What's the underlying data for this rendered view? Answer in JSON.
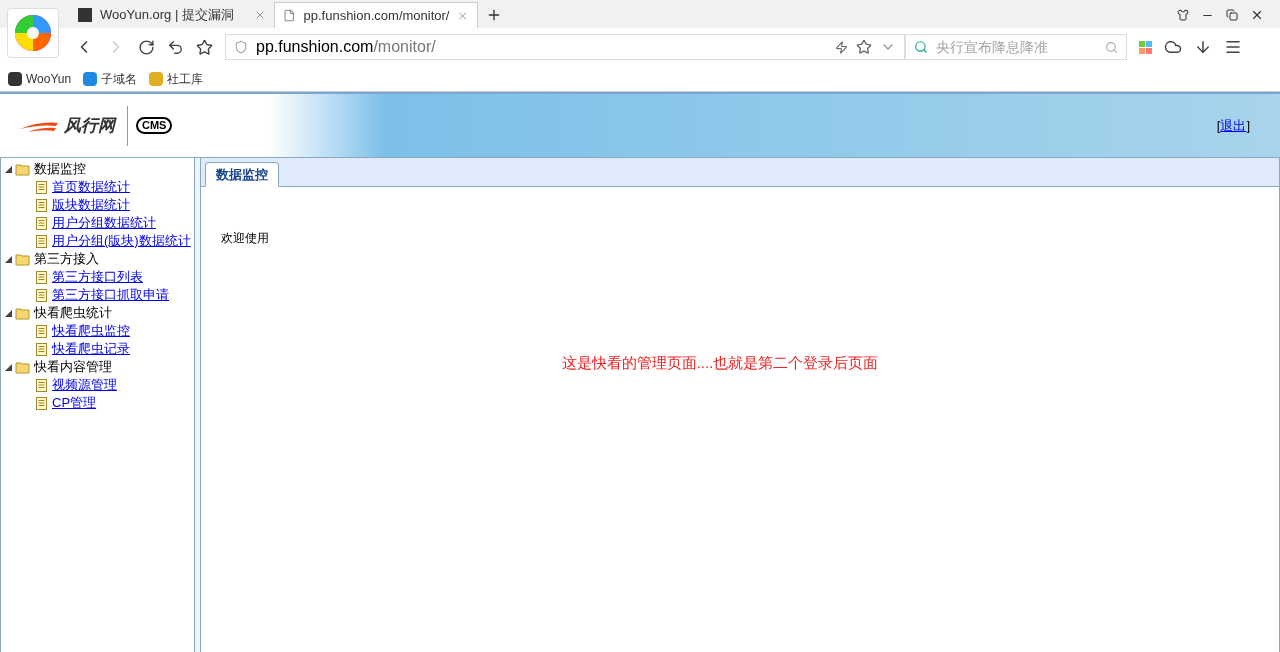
{
  "browser": {
    "tabs": [
      {
        "title": "WooYun.org | 提交漏洞",
        "selected": false
      },
      {
        "title": "pp.funshion.com/monitor/",
        "selected": true
      }
    ],
    "address": {
      "host": "pp.funshion.com",
      "path": "/monitor/"
    },
    "search": {
      "placeholder": "央行宣布降息降准"
    },
    "bookmarks": [
      "WooYun",
      "子域名",
      "社工库"
    ]
  },
  "header": {
    "logo": "风行网",
    "cms": "CMS",
    "logout": {
      "open": "[",
      "label": "退出",
      "close": "]"
    }
  },
  "sidebar": {
    "groups": [
      {
        "label": "数据监控",
        "expanded": true,
        "children": [
          "首页数据统计",
          "版块数据统计",
          "用户分组数据统计",
          "用户分组(版块)数据统计"
        ]
      },
      {
        "label": "第三方接入",
        "expanded": true,
        "children": [
          "第三方接口列表",
          "第三方接口抓取申请"
        ]
      },
      {
        "label": "快看爬虫统计",
        "expanded": true,
        "children": [
          "快看爬虫监控",
          "快看爬虫记录"
        ]
      },
      {
        "label": "快看内容管理",
        "expanded": true,
        "children": [
          "视频源管理",
          "CP管理"
        ]
      }
    ]
  },
  "main": {
    "tabs": [
      {
        "label": "数据监控",
        "selected": true
      }
    ],
    "welcome": "欢迎使用",
    "note": "这是快看的管理页面....也就是第二个登录后页面"
  }
}
